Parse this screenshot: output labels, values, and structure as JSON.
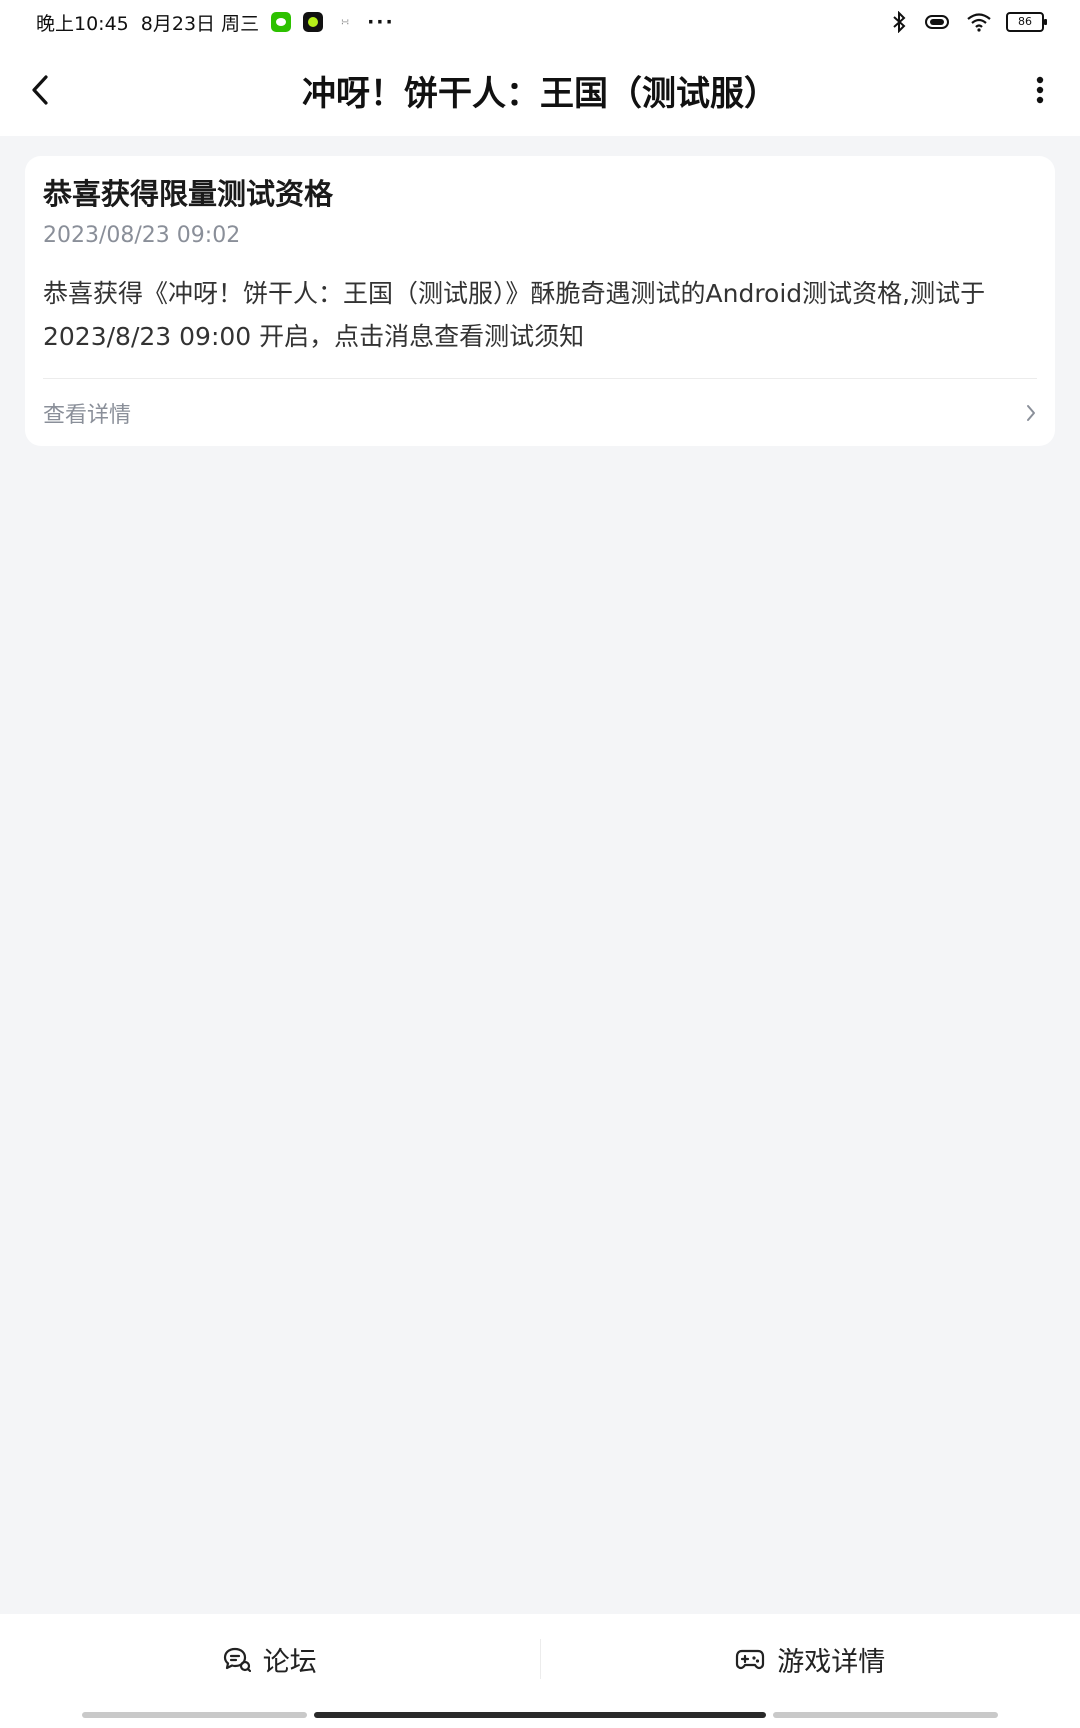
{
  "status_bar": {
    "time": "晚上10:45",
    "date": "8月23日 周三",
    "small_label": "∺",
    "more": "···",
    "battery": "86"
  },
  "header": {
    "title": "冲呀！饼干人：王国（测试服）"
  },
  "notice": {
    "title": "恭喜获得限量测试资格",
    "time": "2023/08/23 09:02",
    "body": "恭喜获得《冲呀！饼干人：王国（测试服）》酥脆奇遇测试的Android测试资格,测试于 2023/8/23 09:00 开启，点击消息查看测试须知",
    "link_label": "查看详情"
  },
  "bottom_bar": {
    "forum_label": "论坛",
    "game_detail_label": "游戏详情"
  },
  "icons": {
    "back": "chevron-left-icon",
    "more": "more-vertical-icon",
    "link_arrow": "chevron-right-icon",
    "forum": "chat-icon",
    "game": "gamepad-icon",
    "bluetooth": "bluetooth-icon",
    "vibrate": "vibrate-icon",
    "wifi": "wifi-icon"
  }
}
